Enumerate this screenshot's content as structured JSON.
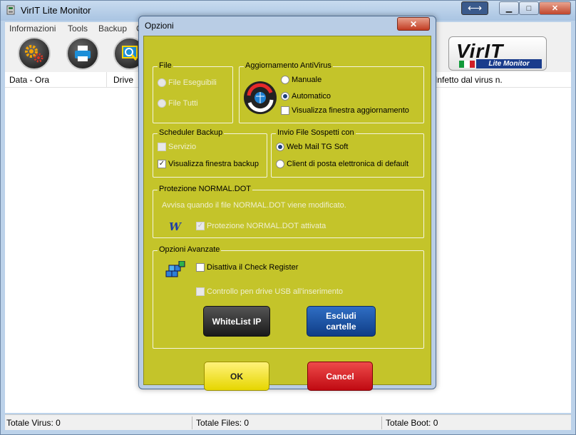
{
  "window": {
    "title": "VirIT Lite Monitor",
    "minimize_glyph": "▁",
    "maximize_glyph": "□",
    "close_glyph": "✕",
    "resize_glyph": "⟷"
  },
  "menu": [
    "Informazioni",
    "Tools",
    "Backup",
    "C"
  ],
  "toolbar": {
    "icons": [
      "gears-icon",
      "printer-icon",
      "scan-icon"
    ],
    "logo_title": "VirIT",
    "logo_sub": "Lite Monitor"
  },
  "list": {
    "columns": [
      "Data - Ora",
      "Drive",
      "Infetto dal virus n."
    ]
  },
  "status": {
    "virus": "Totale Virus: 0",
    "files": "Totale Files: 0",
    "boot": "Totale Boot: 0"
  },
  "dialog": {
    "title": "Opzioni",
    "close_glyph": "✕",
    "file_group": {
      "title": "File",
      "options": [
        "File Eseguibili",
        "File Tutti"
      ]
    },
    "update_group": {
      "title": "Aggiornamento AntiVirus",
      "manual": "Manuale",
      "automatic": "Automatico",
      "show_window": "Visualizza finestra aggiornamento"
    },
    "backup_group": {
      "title": "Scheduler Backup",
      "service": "Servizio",
      "show_window": "Visualizza finestra backup"
    },
    "send_group": {
      "title": "Invio File Sospetti con",
      "webmail": "Web Mail TG Soft",
      "client": "Client di posta elettronica di default"
    },
    "normal_group": {
      "title": "Protezione NORMAL.DOT",
      "note": "Avvisa quando il file NORMAL.DOT viene modificato.",
      "protection": "Protezione NORMAL.DOT attivata",
      "icon_letter": "W"
    },
    "advanced_group": {
      "title": "Opzioni Avanzate",
      "disable_check": "Disattiva il Check Register",
      "usb_control": "Controllo pen drive USB all'inserimento",
      "whitelist": "WhiteList IP",
      "exclude": "Escludi cartelle"
    },
    "ok": "OK",
    "cancel": "Cancel"
  },
  "colors": {
    "dialog_bg": "#c4c42a",
    "ok_bg": "#f2e400",
    "cancel_bg": "#d9101a",
    "whitelist_bg": "#333333",
    "exclude_bg": "#1b4f98"
  }
}
